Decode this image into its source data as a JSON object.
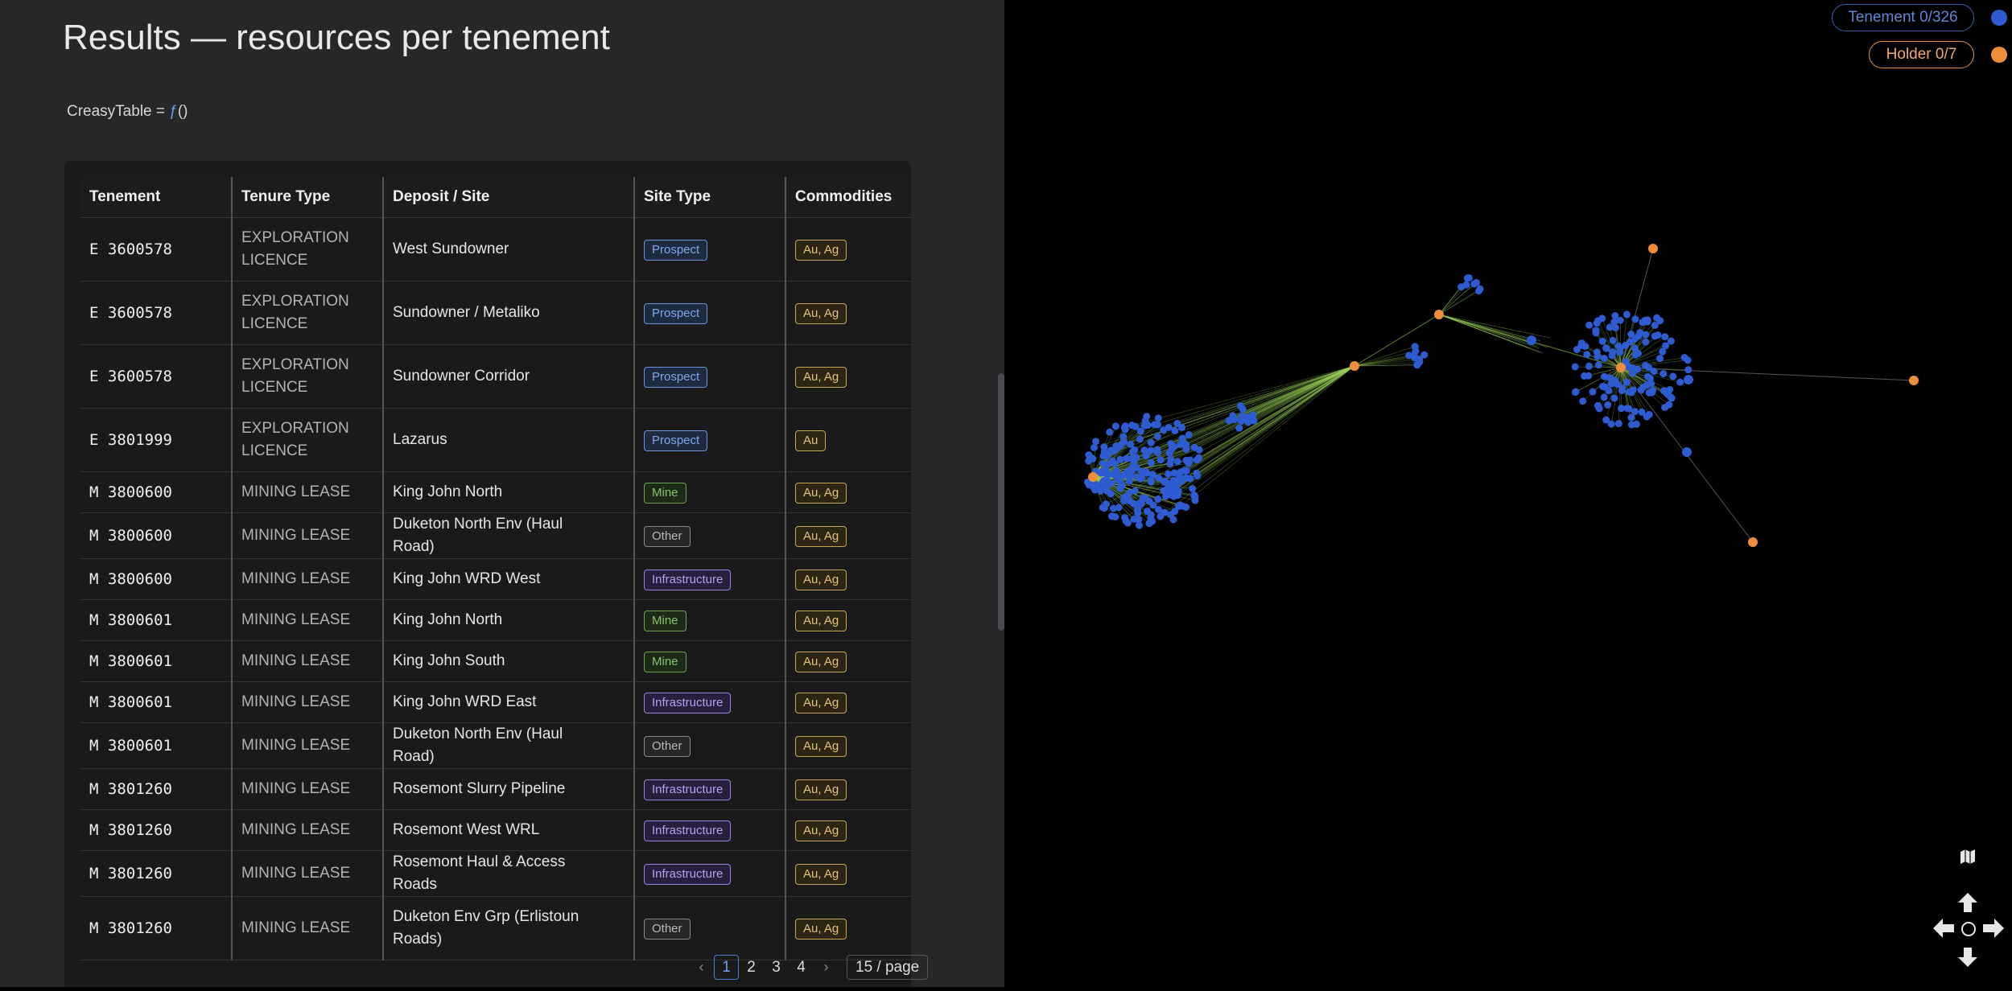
{
  "page": {
    "title": "Results — resources per tenement"
  },
  "code": {
    "prefix": "CreasyTable = ",
    "fn": "ƒ",
    "suffix": "()"
  },
  "table": {
    "headers": [
      "Tenement",
      "Tenure Type",
      "Deposit / Site",
      "Site Type",
      "Commodities"
    ],
    "rows": [
      {
        "tenement": "E 3600578",
        "tenure": "EXPLORATION LICENCE",
        "site": "West Sundowner",
        "type": "Prospect",
        "comm": "Au, Ag"
      },
      {
        "tenement": "E 3600578",
        "tenure": "EXPLORATION LICENCE",
        "site": "Sundowner / Metaliko",
        "type": "Prospect",
        "comm": "Au, Ag"
      },
      {
        "tenement": "E 3600578",
        "tenure": "EXPLORATION LICENCE",
        "site": "Sundowner Corridor",
        "type": "Prospect",
        "comm": "Au, Ag"
      },
      {
        "tenement": "E 3801999",
        "tenure": "EXPLORATION LICENCE",
        "site": "Lazarus",
        "type": "Prospect",
        "comm": "Au"
      },
      {
        "tenement": "M 3800600",
        "tenure": "MINING LEASE",
        "site": "King John North",
        "type": "Mine",
        "comm": "Au, Ag"
      },
      {
        "tenement": "M 3800600",
        "tenure": "MINING LEASE",
        "site": "Duketon North Env (Haul Road)",
        "type": "Other",
        "comm": "Au, Ag"
      },
      {
        "tenement": "M 3800600",
        "tenure": "MINING LEASE",
        "site": "King John WRD West",
        "type": "Infrastructure",
        "comm": "Au, Ag"
      },
      {
        "tenement": "M 3800601",
        "tenure": "MINING LEASE",
        "site": "King John North",
        "type": "Mine",
        "comm": "Au, Ag"
      },
      {
        "tenement": "M 3800601",
        "tenure": "MINING LEASE",
        "site": "King John South",
        "type": "Mine",
        "comm": "Au, Ag"
      },
      {
        "tenement": "M 3800601",
        "tenure": "MINING LEASE",
        "site": "King John WRD East",
        "type": "Infrastructure",
        "comm": "Au, Ag"
      },
      {
        "tenement": "M 3800601",
        "tenure": "MINING LEASE",
        "site": "Duketon North Env (Haul Road)",
        "type": "Other",
        "comm": "Au, Ag"
      },
      {
        "tenement": "M 3801260",
        "tenure": "MINING LEASE",
        "site": "Rosemont Slurry Pipeline",
        "type": "Infrastructure",
        "comm": "Au, Ag"
      },
      {
        "tenement": "M 3801260",
        "tenure": "MINING LEASE",
        "site": "Rosemont West WRL",
        "type": "Infrastructure",
        "comm": "Au, Ag"
      },
      {
        "tenement": "M 3801260",
        "tenure": "MINING LEASE",
        "site": "Rosemont Haul & Access Roads",
        "type": "Infrastructure",
        "comm": "Au, Ag"
      },
      {
        "tenement": "M 3801260",
        "tenure": "MINING LEASE",
        "site": "Duketon Env Grp (Erlistoun Roads)",
        "type": "Other",
        "comm": "Au, Ag"
      }
    ]
  },
  "pager": {
    "prev": "‹",
    "next": "›",
    "pages": [
      "1",
      "2",
      "3",
      "4"
    ],
    "current": "1",
    "page_size": "15 / page"
  },
  "legend": {
    "tenement": "Tenement 0/326",
    "holder": "Holder 0/7"
  },
  "colors": {
    "tenement": "#2e5bd0",
    "holder": "#ee8d3c",
    "edge": "#9bd35a"
  },
  "controls": {
    "map_icon": "map-icon",
    "up": "arrow-up-icon",
    "down": "arrow-down-icon",
    "left": "arrow-left-icon",
    "right": "arrow-right-icon",
    "center": "recenter-icon"
  }
}
